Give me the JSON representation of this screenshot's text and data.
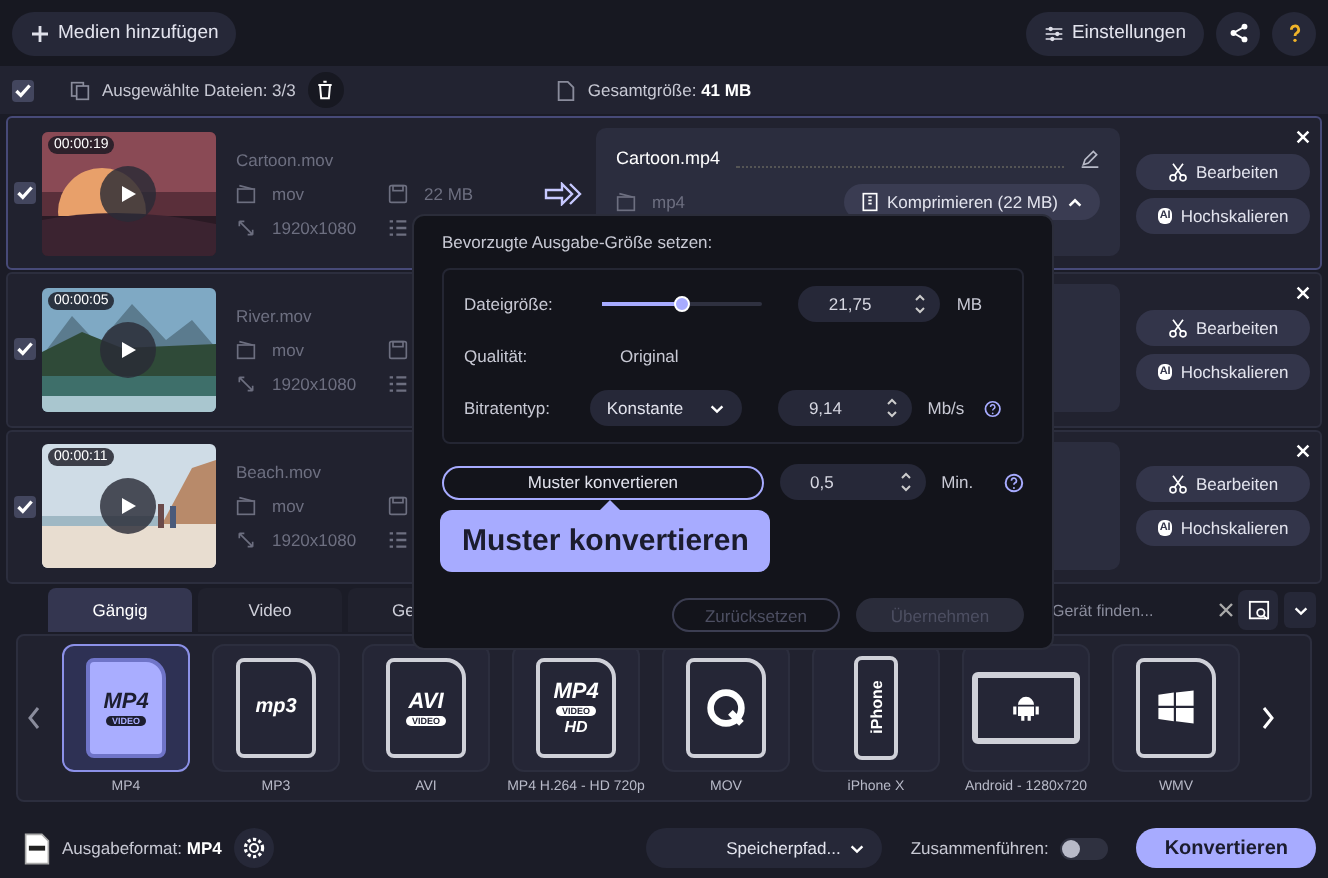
{
  "toolbar": {
    "add_media": "Medien hinzufügen",
    "settings": "Einstellungen"
  },
  "selection": {
    "checked": true,
    "selected_label": "Ausgewählte Dateien:",
    "selected_count": "3/3",
    "total_label": "Gesamtgröße:",
    "total_value": "41 MB"
  },
  "files": [
    {
      "selected": true,
      "checked": true,
      "duration": "00:00:19",
      "name": "Cartoon.mov",
      "format": "mov",
      "size": "22 MB",
      "resolution": "1920x1080",
      "output": {
        "name": "Cartoon.mp4",
        "format": "mp4",
        "compress": "Komprimieren (22 MB)"
      },
      "edit": "Bearbeiten",
      "upscale": "Hochskalieren",
      "ai": "AI"
    },
    {
      "selected": false,
      "checked": true,
      "duration": "00:00:05",
      "name": "River.mov",
      "format": "mov",
      "resolution": "1920x1080",
      "edit": "Bearbeiten",
      "upscale": "Hochskalieren",
      "ai": "AI"
    },
    {
      "selected": false,
      "checked": true,
      "duration": "00:00:11",
      "name": "Beach.mov",
      "format": "mov",
      "resolution": "1920x1080",
      "edit": "Bearbeiten",
      "upscale": "Hochskalieren",
      "ai": "AI"
    }
  ],
  "popup": {
    "title": "Bevorzugte Ausgabe-Größe setzen:",
    "size_label": "Dateigröße:",
    "size_slider": {
      "level": 0.5
    },
    "size_value": "21,75",
    "size_unit": "MB",
    "quality_label": "Qualität:",
    "quality_value": "Original",
    "bitrate_label": "Bitratentyp:",
    "bitrate_type": "Konstante",
    "bitrate_value": "9,14",
    "bitrate_unit": "Mb/s",
    "sample_button": "Muster konvertieren",
    "sample_value": "0,5",
    "sample_unit": "Min.",
    "tooltip": "Muster konvertieren",
    "reset": {
      "label": "Zurücksetzen",
      "disabled": true
    },
    "apply": {
      "label": "Übernehmen",
      "disabled": true
    }
  },
  "tabs": [
    {
      "label": "Gängig",
      "selected": true
    },
    {
      "label": "Video",
      "selected": false
    },
    {
      "label": "Ge",
      "selected": false
    }
  ],
  "device_search": {
    "placeholder": "Gerät finden..."
  },
  "formats": [
    {
      "label": "MP4",
      "kind": "mp4",
      "selected": true,
      "badge": "MP4",
      "sub": "VIDEO"
    },
    {
      "label": "MP3",
      "kind": "mp3",
      "selected": false,
      "badge": "mp3"
    },
    {
      "label": "AVI",
      "kind": "avi",
      "selected": false,
      "badge": "AVI",
      "sub": "VIDEO"
    },
    {
      "label": "MP4 H.264 - HD 720p",
      "kind": "mp4hd",
      "selected": false,
      "badge": "MP4",
      "sub": "VIDEO",
      "extra": "HD"
    },
    {
      "label": "MOV",
      "kind": "mov",
      "selected": false
    },
    {
      "label": "iPhone X",
      "kind": "phone",
      "selected": false,
      "badge": "iPhone"
    },
    {
      "label": "Android - 1280x720",
      "kind": "android",
      "selected": false
    },
    {
      "label": "WMV",
      "kind": "windows",
      "selected": false
    }
  ],
  "bottom": {
    "format_label": "Ausgabeformat:",
    "format_value": "MP4",
    "save_path": "Speicherpfad...",
    "merge_label": "Zusammenführen:",
    "merge_on": false,
    "convert": "Konvertieren"
  }
}
